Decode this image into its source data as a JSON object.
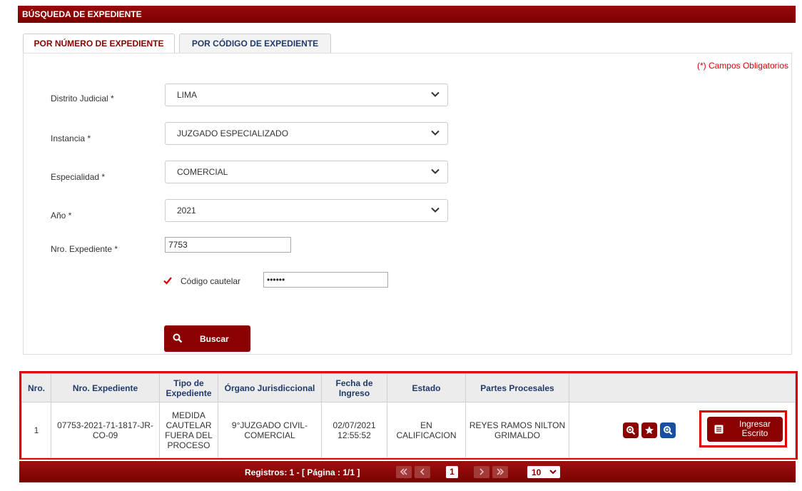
{
  "header": {
    "title": "BÚSQUEDA DE EXPEDIENTE"
  },
  "tabs": [
    {
      "label": "POR NÚMERO DE EXPEDIENTE",
      "active": true
    },
    {
      "label": "POR CÓDIGO DE EXPEDIENTE",
      "active": false
    }
  ],
  "form": {
    "required_note": "(*) Campos Obligatorios",
    "distrito": {
      "label": "Distrito Judicial *",
      "value": "LIMA"
    },
    "instancia": {
      "label": "Instancia *",
      "value": "JUZGADO ESPECIALIZADO"
    },
    "especialidad": {
      "label": "Especialidad *",
      "value": "COMERCIAL"
    },
    "anio": {
      "label": "Año *",
      "value": "2021"
    },
    "nro_expediente": {
      "label": "Nro. Expediente *",
      "value": "7753"
    },
    "codigo_cautelar": {
      "label": "Código cautelar",
      "checked": true,
      "value": "••••••"
    },
    "search_button": "Buscar"
  },
  "table": {
    "headers": [
      "Nro.",
      "Nro. Expediente",
      "Tipo de Expediente",
      "Órgano Jurisdiccional",
      "Fecha de Ingreso",
      "Estado",
      "Partes Procesales",
      ""
    ],
    "rows": [
      {
        "nro": "1",
        "expediente": "07753-2021-71-1817-JR-CO-09",
        "tipo": "MEDIDA CAUTELAR FUERA DEL PROCESO",
        "organo": "9°JUZGADO CIVIL-COMERCIAL",
        "fecha": "02/07/2021 12:55:52",
        "estado": "EN CALIFICACION",
        "partes": "REYES RAMOS NILTON GRIMALDO",
        "action_label": "Ingresar Escrito"
      }
    ]
  },
  "pager": {
    "info": "Registros: 1 - [ Página : 1/1 ]",
    "current_page": "1",
    "page_size": "10"
  },
  "colors": {
    "brand": "#8b0000",
    "accent_blue": "#1a4fa0",
    "highlight": "#e00000"
  },
  "icons": [
    "chevron-down-icon",
    "check-icon",
    "search-icon",
    "zoom-icon",
    "star-icon",
    "document-icon",
    "first-page-icon",
    "prev-page-icon",
    "next-page-icon",
    "last-page-icon"
  ]
}
